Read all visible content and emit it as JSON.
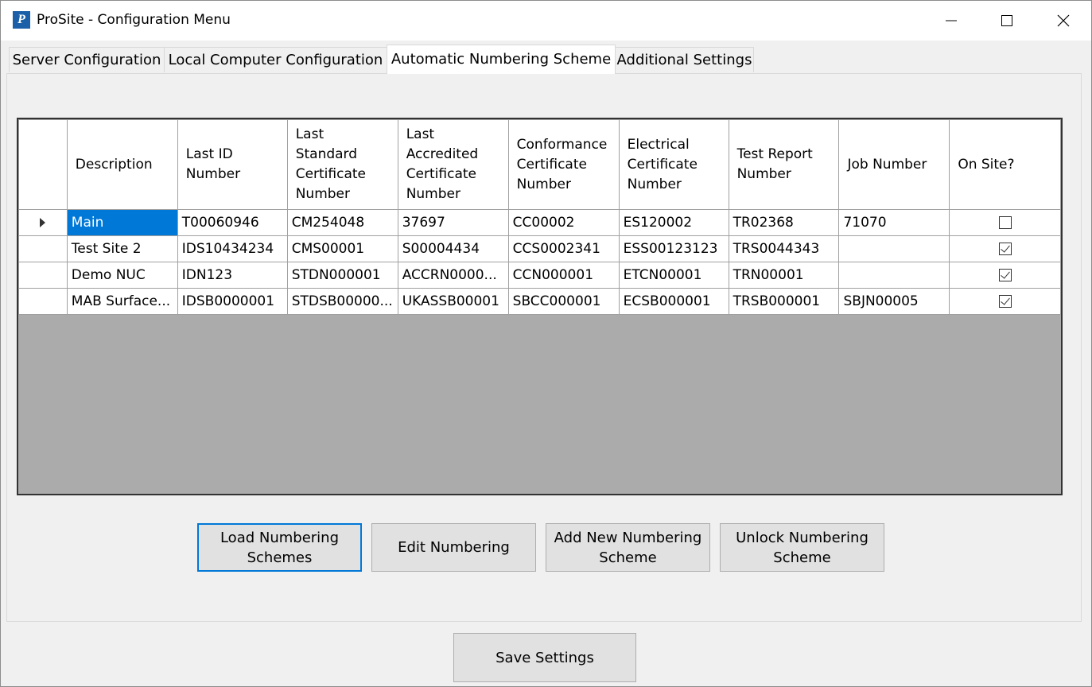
{
  "window": {
    "title": "ProSite - Configuration Menu",
    "app_icon": "prosite-logo-icon"
  },
  "tabs": [
    {
      "label": "Server Configuration",
      "active": false
    },
    {
      "label": "Local Computer Configuration",
      "active": false
    },
    {
      "label": "Automatic Numbering Scheme",
      "active": true
    },
    {
      "label": "Additional Settings",
      "active": false
    }
  ],
  "grid": {
    "columns": [
      "Description",
      "Last ID Number",
      "Last Standard Certificate Number",
      "Last Accredited Certificate Number",
      "Conformance Certificate Number",
      "Electrical Certificate Number",
      "Test Report Number",
      "Job Number",
      "On Site?"
    ],
    "rows": [
      {
        "cells": [
          "Main",
          "T00060946",
          "CM254048",
          "37697",
          "CC00002",
          "ES120002",
          "TR02368",
          "71070"
        ],
        "on_site": false,
        "current": true
      },
      {
        "cells": [
          "Test Site 2",
          "IDS10434234",
          "CMS00001",
          "S00004434",
          "CCS0002341",
          "ESS00123123",
          "TRS0044343",
          ""
        ],
        "on_site": true,
        "current": false
      },
      {
        "cells": [
          "Demo NUC",
          "IDN123",
          "STDN000001",
          "ACCRN0000...",
          "CCN000001",
          "ETCN00001",
          "TRN00001",
          ""
        ],
        "on_site": true,
        "current": false
      },
      {
        "cells": [
          "MAB Surface...",
          "IDSB0000001",
          "STDSB00000...",
          "UKASSB00001",
          "SBCC000001",
          "ECSB000001",
          "TRSB000001",
          "SBJN00005"
        ],
        "on_site": true,
        "current": false
      }
    ]
  },
  "buttons": {
    "load": "Load Numbering\nSchemes",
    "edit": "Edit Numbering",
    "add": "Add New Numbering\nScheme",
    "unlock": "Unlock Numbering\nScheme",
    "save": "Save Settings"
  },
  "colors": {
    "selection": "#0078d7",
    "empty_grid": "#ababab",
    "focus": "#0078d7"
  }
}
